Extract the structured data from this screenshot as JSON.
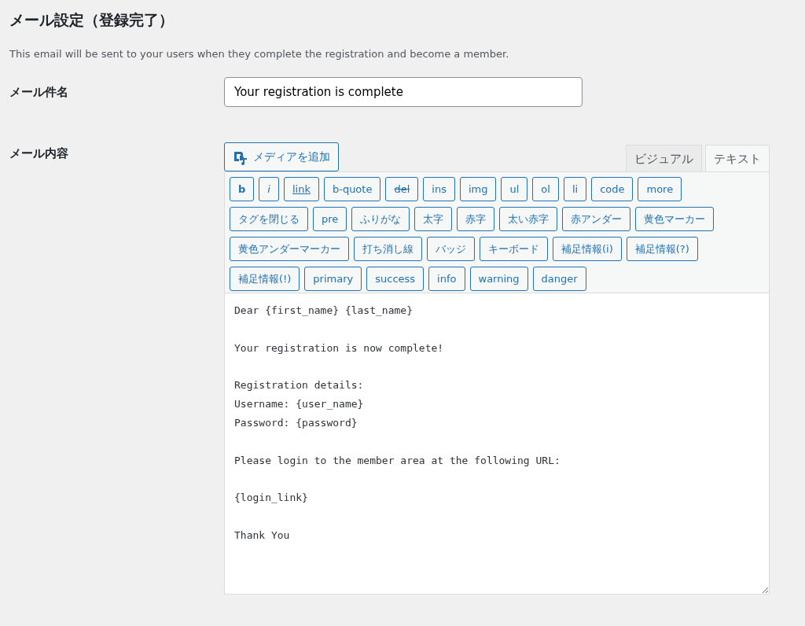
{
  "title": "メール設定（登録完了）",
  "description": "This email will be sent to your users when they complete the registration and become a member.",
  "subject": {
    "label": "メール件名",
    "value": "Your registration is complete"
  },
  "content": {
    "label": "メール内容",
    "media_button": "メディアを追加",
    "tabs": [
      {
        "label": "ビジュアル",
        "selected": false
      },
      {
        "label": "テキスト",
        "selected": true
      }
    ],
    "quicktags": [
      {
        "label": "b",
        "kind": "bold"
      },
      {
        "label": "i",
        "kind": "italic"
      },
      {
        "label": "link",
        "kind": "link"
      },
      {
        "label": "b-quote",
        "kind": "plain"
      },
      {
        "label": "del",
        "kind": "strike"
      },
      {
        "label": "ins",
        "kind": "plain"
      },
      {
        "label": "img",
        "kind": "plain"
      },
      {
        "label": "ul",
        "kind": "plain"
      },
      {
        "label": "ol",
        "kind": "plain"
      },
      {
        "label": "li",
        "kind": "plain"
      },
      {
        "label": "code",
        "kind": "plain"
      },
      {
        "label": "more",
        "kind": "plain"
      },
      {
        "label": "タグを閉じる",
        "kind": "plain"
      },
      {
        "label": "pre",
        "kind": "plain"
      },
      {
        "label": "ふりがな",
        "kind": "plain"
      },
      {
        "label": "太字",
        "kind": "plain"
      },
      {
        "label": "赤字",
        "kind": "plain"
      },
      {
        "label": "太い赤字",
        "kind": "plain"
      },
      {
        "label": "赤アンダー",
        "kind": "plain"
      },
      {
        "label": "黄色マーカー",
        "kind": "plain"
      },
      {
        "label": "黄色アンダーマーカー",
        "kind": "plain"
      },
      {
        "label": "打ち消し線",
        "kind": "plain"
      },
      {
        "label": "バッジ",
        "kind": "plain"
      },
      {
        "label": "キーボード",
        "kind": "plain"
      },
      {
        "label": "補足情報(i)",
        "kind": "plain"
      },
      {
        "label": "補足情報(?)",
        "kind": "plain"
      },
      {
        "label": "補足情報(!)",
        "kind": "plain"
      },
      {
        "label": "primary",
        "kind": "plain"
      },
      {
        "label": "success",
        "kind": "plain"
      },
      {
        "label": "info",
        "kind": "plain"
      },
      {
        "label": "warning",
        "kind": "plain"
      },
      {
        "label": "danger",
        "kind": "plain"
      }
    ],
    "body": "Dear {first_name} {last_name}\n\nYour registration is now complete!\n\nRegistration details:\nUsername: {user_name}\nPassword: {password}\n\nPlease login to the member area at the following URL:\n\n{login_link}\n\nThank You"
  }
}
